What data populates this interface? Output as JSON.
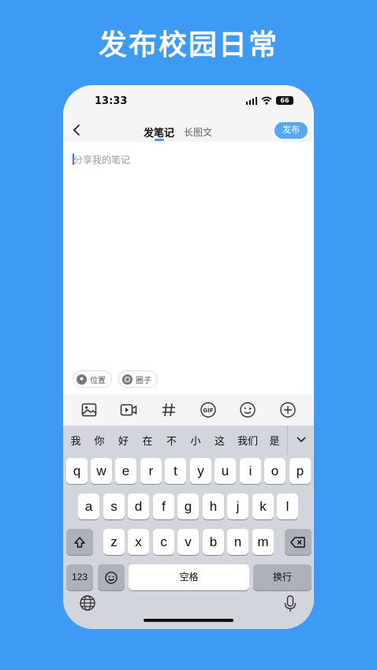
{
  "headline": "发布校园日常",
  "status": {
    "time": "13:33",
    "battery": "66"
  },
  "nav": {
    "tab_active": "发笔记",
    "tab_other": "长图文",
    "publish_label": "发布"
  },
  "editor": {
    "placeholder": "分享我的笔记"
  },
  "chips": [
    {
      "label": "位置",
      "icon": "location-pin-icon"
    },
    {
      "label": "圈子",
      "icon": "circle-group-icon"
    }
  ],
  "toolbar": [
    {
      "icon": "image-icon"
    },
    {
      "icon": "video-icon"
    },
    {
      "icon": "hashtag-icon"
    },
    {
      "icon": "gif-icon",
      "label": "GIF"
    },
    {
      "icon": "emoji-icon"
    },
    {
      "icon": "plus-circle-icon"
    }
  ],
  "keyboard": {
    "candidates": [
      "我",
      "你",
      "好",
      "在",
      "不",
      "小",
      "这",
      "我们",
      "是"
    ],
    "row1": [
      "q",
      "w",
      "e",
      "r",
      "t",
      "y",
      "u",
      "i",
      "o",
      "p"
    ],
    "row2": [
      "a",
      "s",
      "d",
      "f",
      "g",
      "h",
      "j",
      "k",
      "l"
    ],
    "row3": [
      "z",
      "x",
      "c",
      "v",
      "b",
      "n",
      "m"
    ],
    "numbers_label": "123",
    "space_label": "空格",
    "return_label": "换行"
  },
  "colors": {
    "background": "#3d9af5",
    "accent": "#56a8f6"
  }
}
